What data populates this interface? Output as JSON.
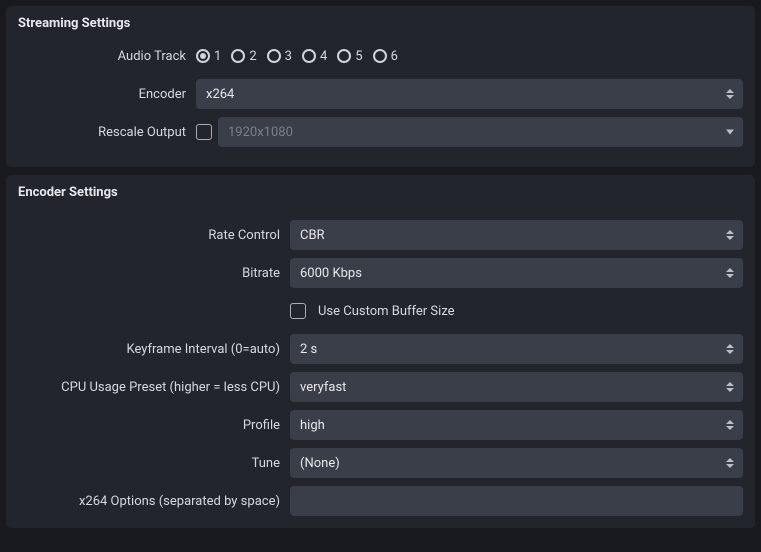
{
  "streaming": {
    "title": "Streaming Settings",
    "audio_track": {
      "label": "Audio Track",
      "options": [
        "1",
        "2",
        "3",
        "4",
        "5",
        "6"
      ],
      "selected": "1"
    },
    "encoder": {
      "label": "Encoder",
      "value": "x264"
    },
    "rescale": {
      "label": "Rescale Output",
      "checked": false,
      "placeholder": "1920x1080"
    }
  },
  "encoder_settings": {
    "title": "Encoder Settings",
    "rate_control": {
      "label": "Rate Control",
      "value": "CBR"
    },
    "bitrate": {
      "label": "Bitrate",
      "value": "6000 Kbps"
    },
    "custom_buffer": {
      "label": "Use Custom Buffer Size",
      "checked": false
    },
    "keyframe": {
      "label": "Keyframe Interval (0=auto)",
      "value": "2 s"
    },
    "cpu_preset": {
      "label": "CPU Usage Preset (higher = less CPU)",
      "value": "veryfast"
    },
    "profile": {
      "label": "Profile",
      "value": "high"
    },
    "tune": {
      "label": "Tune",
      "value": "(None)"
    },
    "x264_options": {
      "label": "x264 Options (separated by space)",
      "value": ""
    }
  }
}
